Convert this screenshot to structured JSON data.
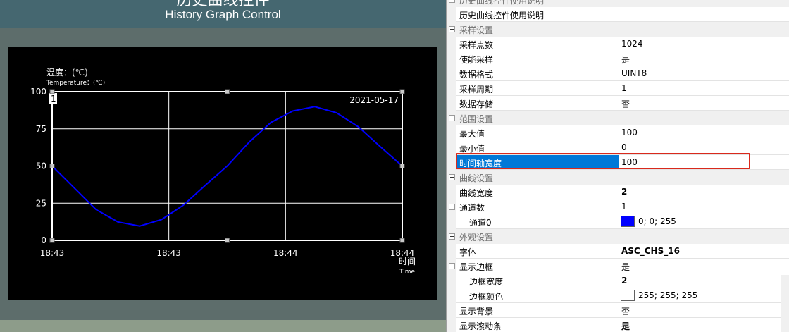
{
  "banner": {
    "title_cn": "历史曲线控件",
    "title_en": "History Graph Control"
  },
  "graph": {
    "y_unit_cn": "温度：(℃)",
    "y_unit_en": "Temperature：(℃)",
    "x_unit_cn": "时间",
    "x_unit_en": "Time",
    "date": "2021-05-17",
    "channel_label": "1",
    "line_color": "#0000ff",
    "grid_color": "#ffffff",
    "background": "#000000"
  },
  "chart_data": {
    "type": "line",
    "x_ticks": [
      "18:43",
      "18:43",
      "18:44",
      "18:44"
    ],
    "y_ticks": [
      0,
      25,
      50,
      75,
      100
    ],
    "ylim": [
      0,
      100
    ],
    "series": [
      {
        "values": [
          50,
          35.4,
          20.8,
          12.4,
          9.6,
          14.0,
          23.7,
          37.0,
          50.0,
          66.0,
          79.3,
          87.0,
          89.9,
          85.8,
          76.3,
          63.0,
          50.0
        ]
      }
    ]
  },
  "properties": {
    "rows": [
      {
        "kind": "category",
        "label": "历史曲线控件使用说明"
      },
      {
        "kind": "prop",
        "name": "历史曲线控件使用说明",
        "value": ""
      },
      {
        "kind": "category",
        "label": "采样设置"
      },
      {
        "kind": "prop",
        "name": "采样点数",
        "value": "1024"
      },
      {
        "kind": "prop",
        "name": "使能采样",
        "value": "是"
      },
      {
        "kind": "prop",
        "name": "数据格式",
        "value": "UINT8"
      },
      {
        "kind": "prop",
        "name": "采样周期",
        "value": "1"
      },
      {
        "kind": "prop",
        "name": "数据存储",
        "value": "否"
      },
      {
        "kind": "category",
        "label": "范围设置"
      },
      {
        "kind": "prop",
        "name": "最大值",
        "value": "100"
      },
      {
        "kind": "prop",
        "name": "最小值",
        "value": "0"
      },
      {
        "kind": "prop",
        "name": "时间轴宽度",
        "value": "100",
        "selected": true
      },
      {
        "kind": "category",
        "label": "曲线设置"
      },
      {
        "kind": "prop",
        "name": "曲线宽度",
        "value": "2",
        "bold": true
      },
      {
        "kind": "prop",
        "name": "通道数",
        "value": "1",
        "expander": true
      },
      {
        "kind": "prop",
        "name": "通道0",
        "value": "0; 0; 255",
        "sub": true,
        "swatch": "#0000ff"
      },
      {
        "kind": "category",
        "label": "外观设置"
      },
      {
        "kind": "prop",
        "name": "字体",
        "value": "ASC_CHS_16",
        "bold": true
      },
      {
        "kind": "prop",
        "name": "显示边框",
        "value": "是",
        "expander": true
      },
      {
        "kind": "prop",
        "name": "边框宽度",
        "value": "2",
        "sub": true,
        "bold": true
      },
      {
        "kind": "prop",
        "name": "边框颜色",
        "value": "255; 255; 255",
        "sub": true,
        "swatch": "#ffffff"
      },
      {
        "kind": "prop",
        "name": "显示背景",
        "value": "否"
      },
      {
        "kind": "prop",
        "name": "显示滚动条",
        "value": "是",
        "bold": true
      }
    ]
  }
}
